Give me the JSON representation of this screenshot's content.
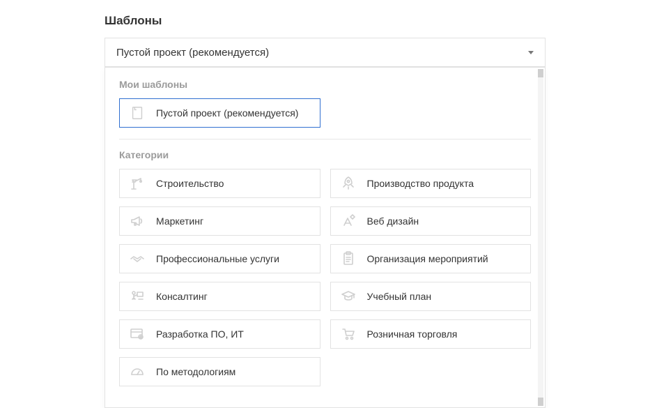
{
  "title": "Шаблоны",
  "select": {
    "current": "Пустой проект (рекомендуется)"
  },
  "dropdown": {
    "myTemplatesLabel": "Мои шаблоны",
    "categoriesLabel": "Категории",
    "blank": {
      "label": "Пустой проект (рекомендуется)"
    },
    "categories": {
      "construction": {
        "label": "Строительство"
      },
      "product": {
        "label": "Производство продукта"
      },
      "marketing": {
        "label": "Маркетинг"
      },
      "webdesign": {
        "label": "Веб дизайн"
      },
      "professional": {
        "label": "Профессиональные услуги"
      },
      "events": {
        "label": "Организация мероприятий"
      },
      "consulting": {
        "label": "Консалтинг"
      },
      "curriculum": {
        "label": "Учебный план"
      },
      "software": {
        "label": "Разработка ПО, ИТ"
      },
      "retail": {
        "label": "Розничная торговля"
      },
      "methodology": {
        "label": "По методологиям"
      }
    }
  }
}
